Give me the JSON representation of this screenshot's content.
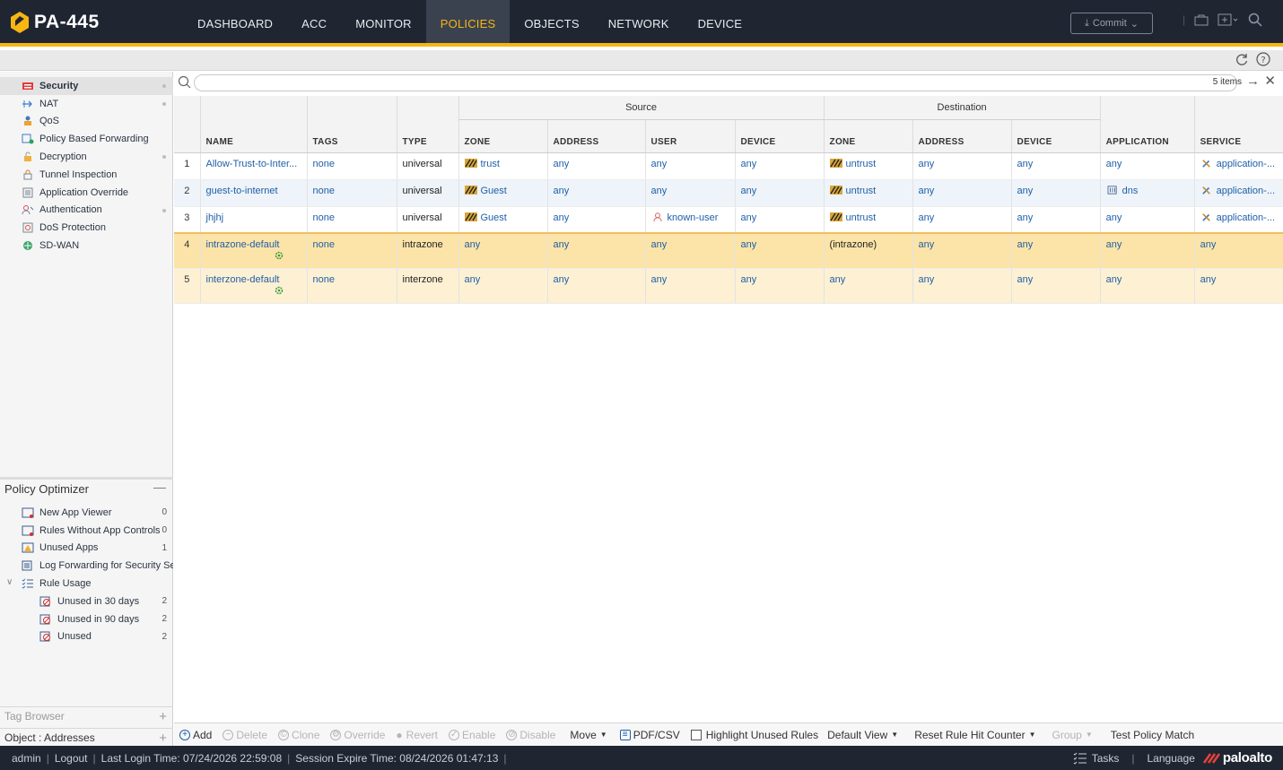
{
  "app": {
    "title": "PA-445"
  },
  "nav": {
    "items": [
      "DASHBOARD",
      "ACC",
      "MONITOR",
      "POLICIES",
      "OBJECTS",
      "NETWORK",
      "DEVICE"
    ],
    "active": "POLICIES",
    "commit_label": "Commit"
  },
  "sidebar": {
    "policies": [
      {
        "label": "Security",
        "selected": true
      },
      {
        "label": "NAT"
      },
      {
        "label": "QoS"
      },
      {
        "label": "Policy Based Forwarding"
      },
      {
        "label": "Decryption"
      },
      {
        "label": "Tunnel Inspection"
      },
      {
        "label": "Application Override"
      },
      {
        "label": "Authentication"
      },
      {
        "label": "DoS Protection"
      },
      {
        "label": "SD-WAN"
      }
    ],
    "optimizer": {
      "title": "Policy Optimizer",
      "items": [
        {
          "label": "New App Viewer",
          "count": "0"
        },
        {
          "label": "Rules Without App Controls",
          "count": "0"
        },
        {
          "label": "Unused Apps",
          "count": "1"
        },
        {
          "label": "Log Forwarding for Security Ser",
          "count": ""
        },
        {
          "label": "Rule Usage",
          "count": ""
        },
        {
          "label": "Unused in 30 days",
          "count": "2"
        },
        {
          "label": "Unused in 90 days",
          "count": "2"
        },
        {
          "label": "Unused",
          "count": "2"
        }
      ]
    },
    "tag_browser": "Tag Browser",
    "object_addresses": "Object : Addresses"
  },
  "search": {
    "items_count": "5 items"
  },
  "table": {
    "group_headers": {
      "source": "Source",
      "destination": "Destination"
    },
    "columns": {
      "name": "NAME",
      "tags": "TAGS",
      "type": "TYPE",
      "src_zone": "ZONE",
      "src_address": "ADDRESS",
      "src_user": "USER",
      "src_device": "DEVICE",
      "dst_zone": "ZONE",
      "dst_address": "ADDRESS",
      "dst_device": "DEVICE",
      "application": "APPLICATION",
      "service": "SERVICE"
    },
    "rows": [
      {
        "num": "1",
        "name": "Allow-Trust-to-Inter...",
        "tags": "none",
        "type": "universal",
        "src_zone": "trust",
        "src_address": "any",
        "src_user": "any",
        "src_device": "any",
        "dst_zone": "untrust",
        "dst_address": "any",
        "dst_device": "any",
        "application": "any",
        "service": "application-..."
      },
      {
        "num": "2",
        "name": "guest-to-internet",
        "tags": "none",
        "type": "universal",
        "src_zone": "Guest",
        "src_address": "any",
        "src_user": "any",
        "src_device": "any",
        "dst_zone": "untrust",
        "dst_address": "any",
        "dst_device": "any",
        "application": "dns",
        "service": "application-..."
      },
      {
        "num": "3",
        "name": "jhjhj",
        "tags": "none",
        "type": "universal",
        "src_zone": "Guest",
        "src_address": "any",
        "src_user": "known-user",
        "src_device": "any",
        "dst_zone": "untrust",
        "dst_address": "any",
        "dst_device": "any",
        "application": "any",
        "service": "application-..."
      },
      {
        "num": "4",
        "name": "intrazone-default",
        "tags": "none",
        "type": "intrazone",
        "src_zone": "any",
        "src_address": "any",
        "src_user": "any",
        "src_device": "any",
        "dst_zone": "(intrazone)",
        "dst_address": "any",
        "dst_device": "any",
        "application": "any",
        "service": "any"
      },
      {
        "num": "5",
        "name": "interzone-default",
        "tags": "none",
        "type": "interzone",
        "src_zone": "any",
        "src_address": "any",
        "src_user": "any",
        "src_device": "any",
        "dst_zone": "any",
        "dst_address": "any",
        "dst_device": "any",
        "application": "any",
        "service": "any"
      }
    ]
  },
  "actions": {
    "add": "Add",
    "delete": "Delete",
    "clone": "Clone",
    "override": "Override",
    "revert": "Revert",
    "enable": "Enable",
    "disable": "Disable",
    "move": "Move",
    "pdf_csv": "PDF/CSV",
    "highlight_unused": "Highlight Unused Rules",
    "default_view": "Default View",
    "reset_counter": "Reset Rule Hit Counter",
    "group": "Group",
    "test_policy": "Test Policy Match"
  },
  "status": {
    "user": "admin",
    "logout": "Logout",
    "last_login": "Last Login Time: 07/24/2026 22:59:08",
    "session_expire": "Session Expire Time: 08/24/2026 01:47:13",
    "tasks": "Tasks",
    "language": "Language",
    "brand": "paloalto"
  },
  "colors": {
    "nav_bg": "#1f2632",
    "accent": "#f7b612",
    "link": "#1f5fa8",
    "default_row": "#fdf0d3"
  }
}
